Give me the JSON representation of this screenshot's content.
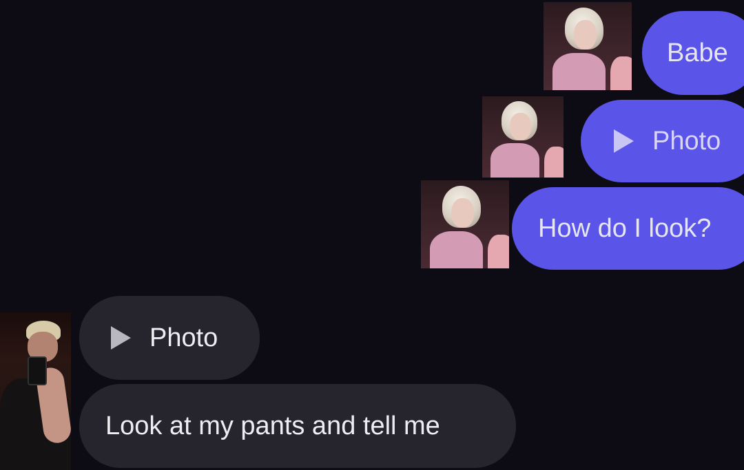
{
  "messages": {
    "sent": [
      {
        "kind": "text",
        "text": "Babe"
      },
      {
        "kind": "photo",
        "text": "Photo"
      },
      {
        "kind": "text",
        "text": "How do I look?"
      }
    ],
    "received": [
      {
        "kind": "photo",
        "text": "Photo"
      },
      {
        "kind": "text",
        "text": "Look at my pants and tell me"
      }
    ]
  },
  "colors": {
    "background": "#0d0c14",
    "sent_bubble": "#5a54e8",
    "received_bubble": "#26252e",
    "text": "#e6e6f0"
  },
  "icons": {
    "play": "play-icon"
  }
}
